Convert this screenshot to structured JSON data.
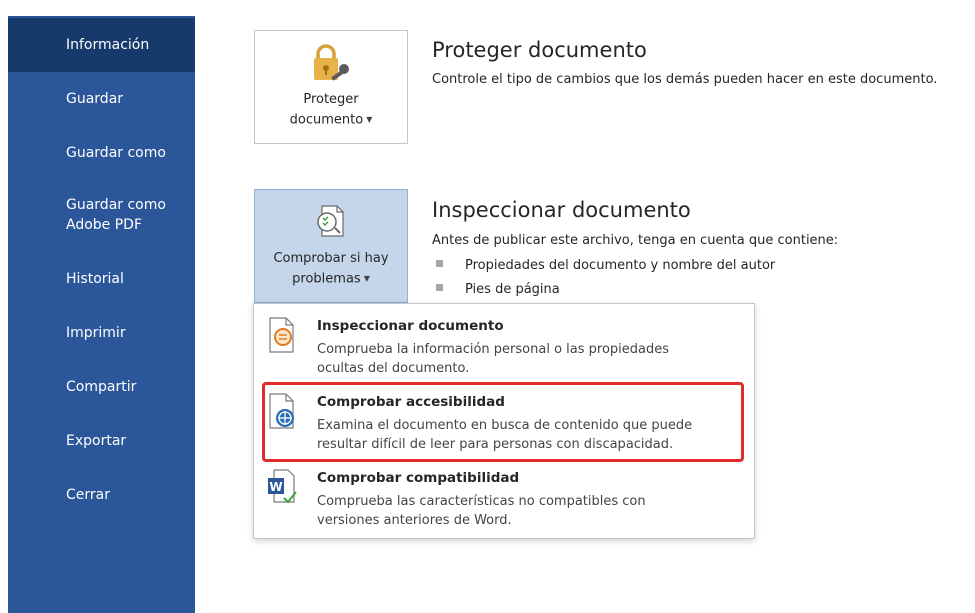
{
  "sidebar": {
    "items": [
      {
        "label": "Información",
        "active": true
      },
      {
        "label": "Guardar"
      },
      {
        "label": "Guardar como"
      },
      {
        "label": "Guardar como\nAdobe PDF"
      },
      {
        "label": "Historial"
      },
      {
        "label": "Imprimir"
      },
      {
        "label": "Compartir"
      },
      {
        "label": "Exportar"
      },
      {
        "label": "Cerrar"
      }
    ]
  },
  "protect": {
    "tile_label_line1": "Proteger",
    "tile_label_line2": "documento",
    "heading": "Proteger documento",
    "description": "Controle el tipo de cambios que los demás pueden hacer en este documento."
  },
  "inspect": {
    "tile_label_line1": "Comprobar si hay",
    "tile_label_line2": "problemas",
    "heading": "Inspeccionar documento",
    "description": "Antes de publicar este archivo, tenga en cuenta que contiene:",
    "bullets": [
      "Propiedades del documento y nombre del autor",
      "Pies de página"
    ]
  },
  "menu": {
    "items": [
      {
        "title": "Inspeccionar documento",
        "description": "Comprueba la información personal o las propiedades\nocultas del documento."
      },
      {
        "title": "Comprobar accesibilidad",
        "description": "Examina el documento en busca de contenido que puede\nresultar difícil de leer para personas con discapacidad."
      },
      {
        "title": "Comprobar compatibilidad",
        "description": "Comprueba las características no compatibles con\nversiones anteriores de Word."
      }
    ]
  },
  "colors": {
    "sidebar_bg": "#2b579a",
    "sidebar_active": "#163a6b",
    "highlight_border": "#e02b2b",
    "pressed_tile": "#c5d5ea"
  }
}
